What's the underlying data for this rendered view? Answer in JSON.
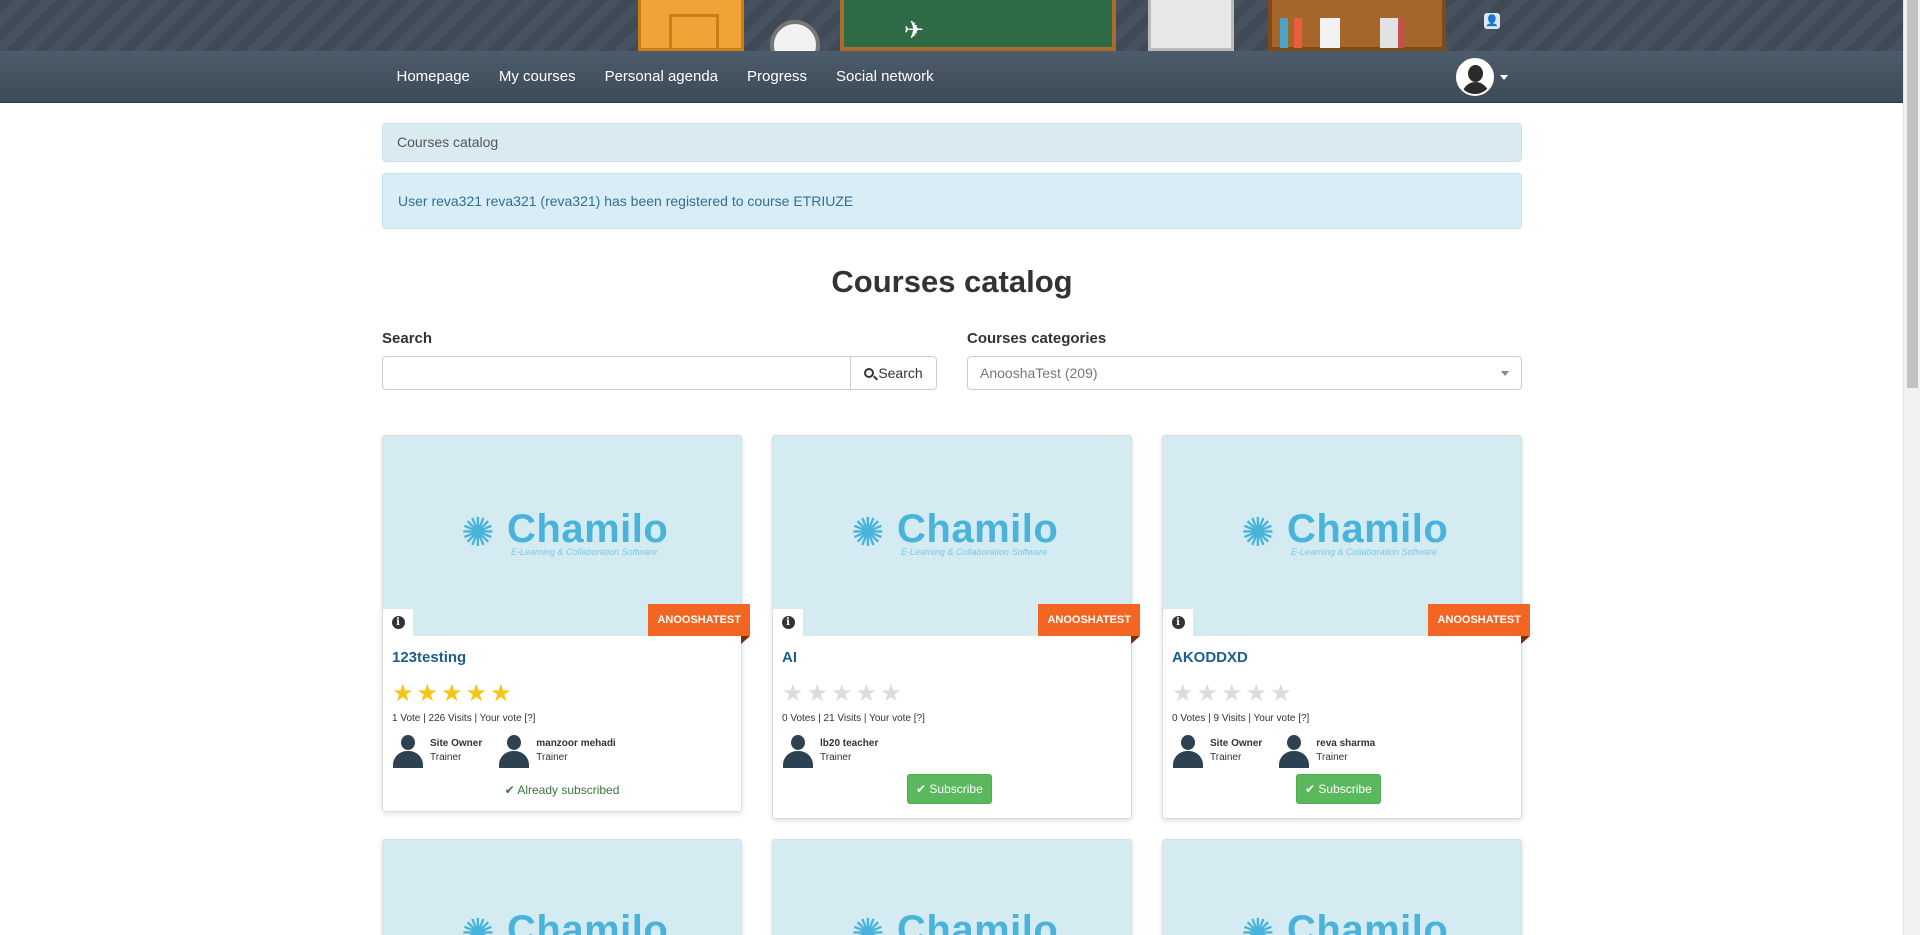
{
  "nav": {
    "items": [
      {
        "label": "Homepage"
      },
      {
        "label": "My courses"
      },
      {
        "label": "Personal agenda"
      },
      {
        "label": "Progress"
      },
      {
        "label": "Social network"
      }
    ]
  },
  "breadcrumb": {
    "label": "Courses catalog"
  },
  "alert": {
    "message": "User reva321 reva321 (reva321) has been registered to course ETRIUZE"
  },
  "page": {
    "title": "Courses catalog"
  },
  "search": {
    "label": "Search",
    "value": "",
    "button_label": "Search"
  },
  "categories": {
    "label": "Courses categories",
    "selected": "AnooshaTest (209)"
  },
  "logo": {
    "word": "Chamilo",
    "tagline": "E-Learning & Collaboration Software"
  },
  "courses": [
    {
      "title": "123testing",
      "category": "ANOOSHATEST",
      "rating": 5,
      "stats": "1 Vote | 226 Visits | Your vote [?]",
      "teachers": [
        {
          "name": "Site Owner",
          "role": "Trainer"
        },
        {
          "name": "manzoor mehadi",
          "role": "Trainer"
        }
      ],
      "status": "Already subscribed"
    },
    {
      "title": "AI",
      "category": "ANOOSHATEST",
      "rating": 0,
      "stats": "0 Votes | 21 Visits | Your vote [?]",
      "teachers": [
        {
          "name": "lb20 teacher",
          "role": "Trainer"
        }
      ],
      "action": "Subscribe"
    },
    {
      "title": "AKODDXD",
      "category": "ANOOSHATEST",
      "rating": 0,
      "stats": "0 Votes | 9 Visits | Your vote [?]",
      "teachers": [
        {
          "name": "Site Owner",
          "role": "Trainer"
        },
        {
          "name": "reva sharma",
          "role": "Trainer"
        }
      ],
      "action": "Subscribe"
    }
  ],
  "colors": {
    "accent": "#1f5d8c",
    "ribbon": "#f26522",
    "subscribe": "#5cb85c",
    "star": "#f5c518"
  }
}
